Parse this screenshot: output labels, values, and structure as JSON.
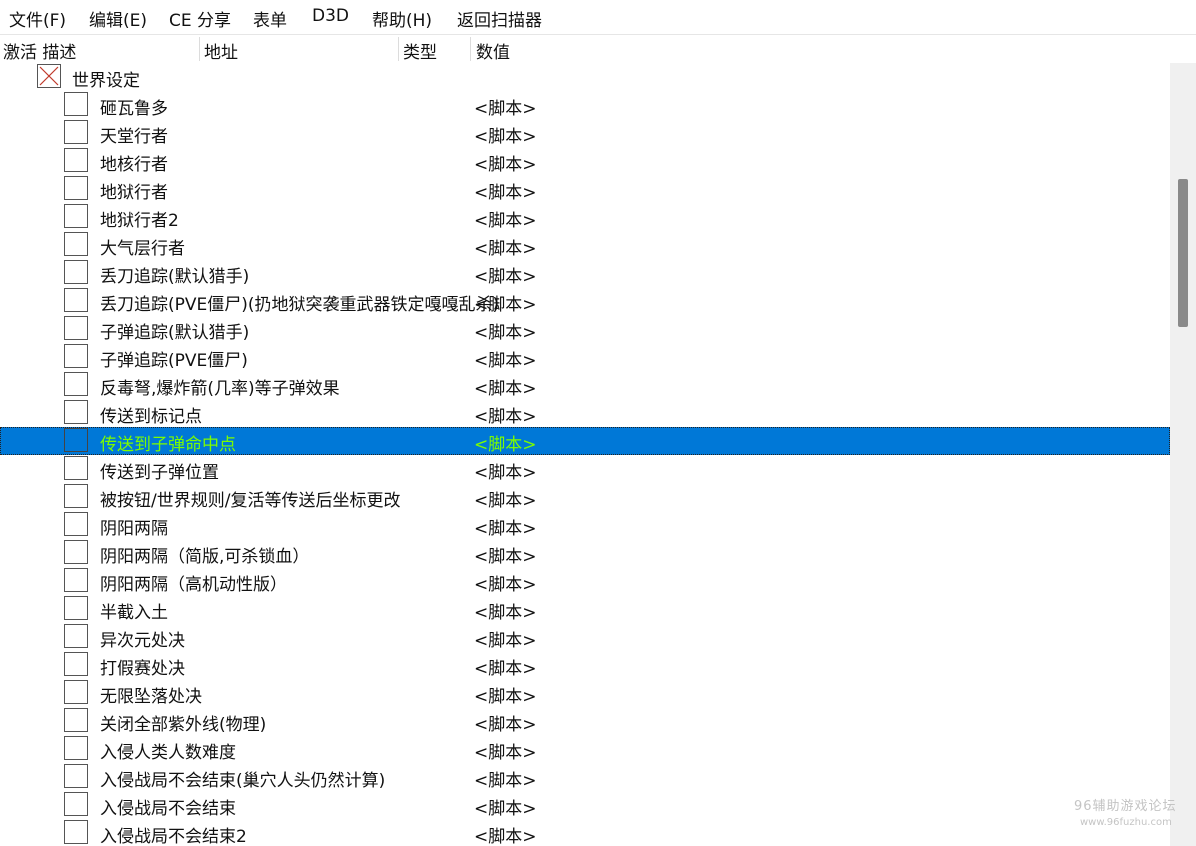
{
  "menu": [
    "文件(F)",
    "编辑(E)",
    "CE 分享",
    "表单",
    "D3D",
    "帮助(H)",
    "返回扫描器"
  ],
  "columns": {
    "active_desc": "激活 描述",
    "address": "地址",
    "type": "类型",
    "value": "数值"
  },
  "group": {
    "label": "世界设定",
    "checked": true
  },
  "rows": [
    {
      "label": "砸瓦鲁多",
      "value": "<脚本>"
    },
    {
      "label": "天堂行者",
      "value": "<脚本>"
    },
    {
      "label": "地核行者",
      "value": "<脚本>"
    },
    {
      "label": "地狱行者",
      "value": "<脚本>"
    },
    {
      "label": "地狱行者2",
      "value": "<脚本>"
    },
    {
      "label": "大气层行者",
      "value": "<脚本>"
    },
    {
      "label": "丢刀追踪(默认猎手)",
      "value": "<脚本>"
    },
    {
      "label": "丢刀追踪(PVE僵尸)(扔地狱突袭重武器铁定嘎嘎乱杀)",
      "value": "<脚本>"
    },
    {
      "label": "子弹追踪(默认猎手)",
      "value": "<脚本>"
    },
    {
      "label": "子弹追踪(PVE僵尸)",
      "value": "<脚本>"
    },
    {
      "label": "反毒弩,爆炸箭(几率)等子弹效果",
      "value": "<脚本>"
    },
    {
      "label": "传送到标记点",
      "value": "<脚本>"
    },
    {
      "label": "传送到子弹命中点",
      "value": "<脚本>",
      "selected": true
    },
    {
      "label": "传送到子弹位置",
      "value": "<脚本>"
    },
    {
      "label": "被按钮/世界规则/复活等传送后坐标更改",
      "value": "<脚本>"
    },
    {
      "label": "阴阳两隔",
      "value": "<脚本>"
    },
    {
      "label": "阴阳两隔（简版,可杀锁血）",
      "value": "<脚本>"
    },
    {
      "label": "阴阳两隔（高机动性版）",
      "value": "<脚本>"
    },
    {
      "label": "半截入土",
      "value": "<脚本>"
    },
    {
      "label": "异次元处决",
      "value": "<脚本>"
    },
    {
      "label": "打假赛处决",
      "value": "<脚本>"
    },
    {
      "label": "无限坠落处决",
      "value": "<脚本>"
    },
    {
      "label": "关闭全部紫外线(物理)",
      "value": "<脚本>"
    },
    {
      "label": "入侵人类人数难度",
      "value": "<脚本>"
    },
    {
      "label": "入侵战局不会结束(巢穴人头仍然计算)",
      "value": "<脚本>"
    },
    {
      "label": "入侵战局不会结束",
      "value": "<脚本>"
    },
    {
      "label": "入侵战局不会结束2",
      "value": "<脚本>"
    }
  ],
  "watermark": {
    "line1": "96辅助游戏论坛",
    "line2": "www.96fuzhu.com"
  },
  "colors": {
    "selection_bg": "#0078d7",
    "selection_text": "#7CFC00"
  }
}
